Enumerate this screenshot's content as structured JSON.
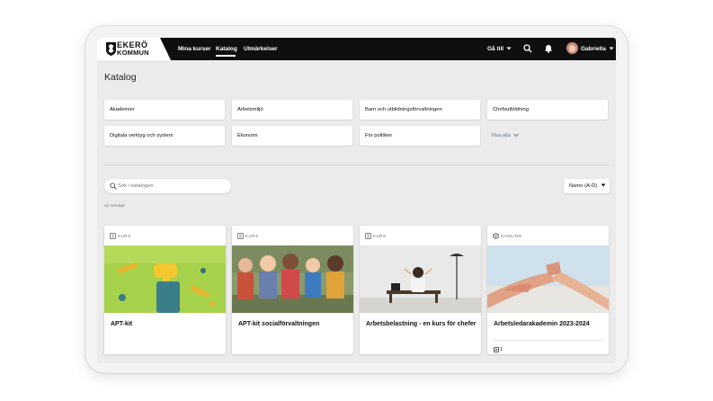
{
  "brand": {
    "line1": "EKERÖ",
    "line2": "KOMMUN"
  },
  "nav": {
    "items": [
      {
        "label": "Mina kurser"
      },
      {
        "label": "Katalog"
      },
      {
        "label": "Utmärkelser"
      }
    ],
    "goto_label": "Gå till",
    "user_name": "Gabriella"
  },
  "page_title": "Katalog",
  "categories": [
    "Akademier",
    "Arbetsmiljö",
    "Barn och utbildningsförvaltningen",
    "Chefsutbildning",
    "Digitala verktyg och system",
    "Ekonomi",
    "För politiker"
  ],
  "show_all_label": "Visa alla",
  "search": {
    "placeholder": "Sök i katalogen"
  },
  "sort_label": "Namn (A-Ö)",
  "results_text": "42 resultat",
  "cards": [
    {
      "type": "KURS",
      "title": "APT-kit",
      "icon": "course-icon"
    },
    {
      "type": "KURS",
      "title": "APT-kit socialförvaltningen",
      "icon": "course-icon"
    },
    {
      "type": "KURS",
      "title": "Arbetsbelastning - en kurs för chefer",
      "icon": "course-icon"
    },
    {
      "type": "SAMLING",
      "title": "Arbetsledarakademin 2023-2024",
      "icon": "collection-icon",
      "count": "1"
    }
  ],
  "colors": {
    "topbar": "#0f0f10",
    "background": "#ebebeb",
    "show_all": "#657189"
  }
}
